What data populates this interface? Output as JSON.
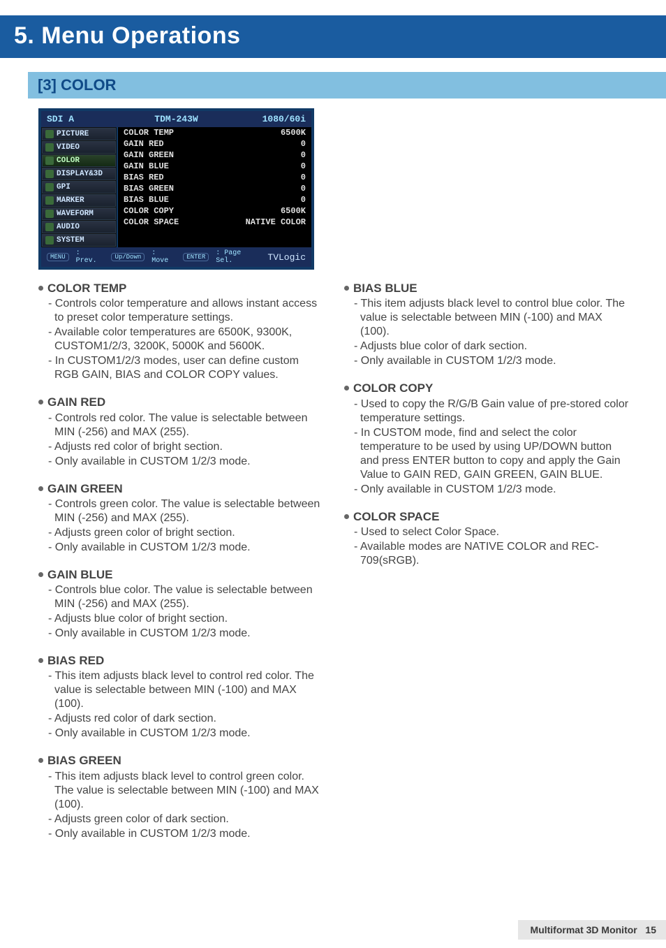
{
  "chapter": "5. Menu Operations",
  "section": "[3] COLOR",
  "osd": {
    "title_left": "SDI A",
    "title_center": "TDM-243W",
    "title_right": "1080/60i",
    "menu": [
      "PICTURE",
      "VIDEO",
      "COLOR",
      "DISPLAY&3D",
      "GPI",
      "MARKER",
      "WAVEFORM",
      "AUDIO",
      "SYSTEM"
    ],
    "active_menu": "COLOR",
    "rows": [
      {
        "k": "COLOR TEMP",
        "v": "6500K"
      },
      {
        "k": "GAIN RED",
        "v": "0"
      },
      {
        "k": "GAIN GREEN",
        "v": "0"
      },
      {
        "k": "GAIN BLUE",
        "v": "0"
      },
      {
        "k": "BIAS RED",
        "v": "0"
      },
      {
        "k": "BIAS GREEN",
        "v": "0"
      },
      {
        "k": "BIAS BLUE",
        "v": "0"
      },
      {
        "k": "COLOR COPY",
        "v": "6500K"
      },
      {
        "k": "COLOR SPACE",
        "v": "NATIVE COLOR"
      }
    ],
    "footer": {
      "b1": "MENU",
      "t1": ": Prev.",
      "b2": "Up/Down",
      "t2": ": Move",
      "b3": "ENTER",
      "t3": ": Page Sel.",
      "brand": "TVLogic"
    }
  },
  "left": [
    {
      "h": "COLOR TEMP",
      "items": [
        "Controls color temperature and allows instant access to preset color temperature settings.",
        "Available color temperatures are 6500K, 9300K, CUSTOM1/2/3, 3200K, 5000K and 5600K.",
        "In CUSTOM1/2/3 modes, user can define custom RGB GAIN, BIAS and COLOR COPY values."
      ]
    },
    {
      "h": "GAIN RED",
      "items": [
        "Controls red color. The value is selectable between MIN (-256) and MAX (255).",
        "Adjusts red color of bright section.",
        "Only available in CUSTOM 1/2/3 mode."
      ]
    },
    {
      "h": "GAIN GREEN",
      "items": [
        "Controls green color. The value is selectable between MIN (-256) and MAX (255).",
        "Adjusts green color of bright section.",
        "Only available in CUSTOM 1/2/3 mode."
      ]
    },
    {
      "h": "GAIN BLUE",
      "items": [
        "Controls blue color. The value is selectable between MIN (-256) and MAX (255).",
        "Adjusts blue color of bright section.",
        "Only available in CUSTOM 1/2/3 mode."
      ]
    },
    {
      "h": "BIAS RED",
      "items": [
        "This item adjusts black level to control red color. The value is selectable between MIN (-100) and MAX (100).",
        "Adjusts red color of dark section.",
        "Only available in CUSTOM 1/2/3 mode."
      ]
    },
    {
      "h": "BIAS GREEN",
      "items": [
        "This item adjusts black level to control green color. The value is selectable between MIN (-100) and MAX (100).",
        "Adjusts green color of dark section.",
        "Only available in CUSTOM 1/2/3 mode."
      ]
    }
  ],
  "right": [
    {
      "h": "BIAS BLUE",
      "items": [
        "This item adjusts black level to control blue color. The value is selectable between MIN (-100) and MAX (100).",
        "Adjusts blue color of dark section.",
        "Only available in CUSTOM 1/2/3 mode."
      ]
    },
    {
      "h": "COLOR COPY",
      "items": [
        "Used to copy the R/G/B Gain value of pre-stored color temperature settings.",
        "In CUSTOM mode, find and select the color temperature to be used by using UP/DOWN button and press ENTER button to copy and apply the Gain Value to GAIN RED, GAIN GREEN, GAIN BLUE.",
        "Only available in CUSTOM 1/2/3 mode."
      ]
    },
    {
      "h": "COLOR SPACE",
      "items": [
        "Used to select Color Space.",
        "Available modes are NATIVE COLOR and REC-709(sRGB)."
      ]
    }
  ],
  "footer": {
    "label": "Multiformat 3D Monitor",
    "page": "15"
  }
}
